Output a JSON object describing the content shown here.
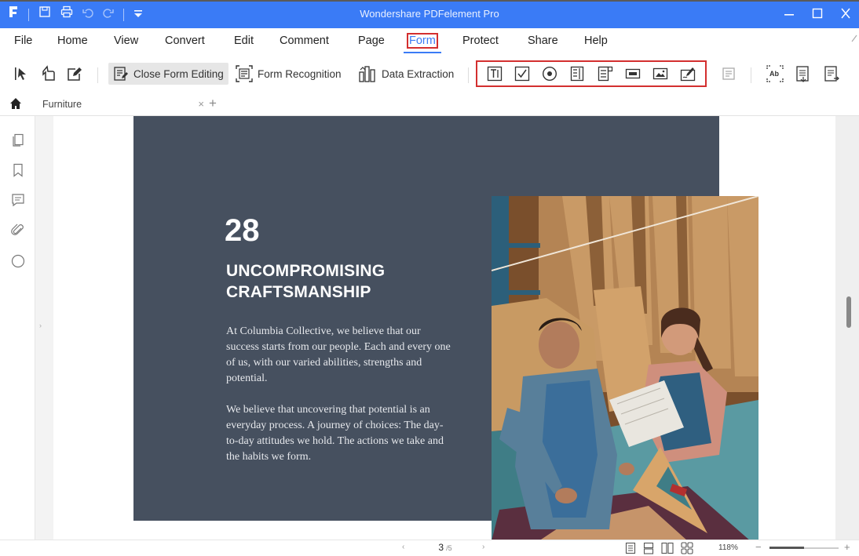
{
  "window": {
    "title": "Wondershare PDFelement Pro"
  },
  "quick_access": {
    "icons": [
      "app-logo-icon",
      "save-icon",
      "print-icon",
      "undo-icon",
      "redo-icon",
      "customize-icon"
    ]
  },
  "menu": {
    "items": [
      {
        "label": "File"
      },
      {
        "label": "Home"
      },
      {
        "label": "View"
      },
      {
        "label": "Convert"
      },
      {
        "label": "Edit"
      },
      {
        "label": "Comment"
      },
      {
        "label": "Page"
      },
      {
        "label": "Form"
      },
      {
        "label": "Protect"
      },
      {
        "label": "Share"
      },
      {
        "label": "Help"
      }
    ],
    "active": "Form"
  },
  "toolbar": {
    "close_form_editing": "Close Form Editing",
    "form_recognition": "Form Recognition",
    "data_extraction": "Data Extraction",
    "field_tools": [
      "text-field",
      "check-box",
      "radio-button",
      "list-box",
      "combo-box",
      "button",
      "image-field",
      "digital-signature"
    ]
  },
  "tabs": [
    {
      "label": "Furniture"
    }
  ],
  "document": {
    "number": "28",
    "heading": "UNCOMPROMISING CRAFTSMANSHIP",
    "paragraph1": "At Columbia Collective, we believe that our success starts from our people. Each and every one of us, with our varied abilities, strengths and potential.",
    "paragraph2": "We believe that uncovering that potential is an everyday process. A journey of choices: The day-to-day attitudes we hold. The actions we take and the habits we form."
  },
  "status": {
    "current_page": "3",
    "total_pages": "/5",
    "zoom": "118%"
  },
  "colors": {
    "accent": "#3a7bf6",
    "highlight_box": "#d32f2f",
    "page_dark": "#46505f"
  }
}
